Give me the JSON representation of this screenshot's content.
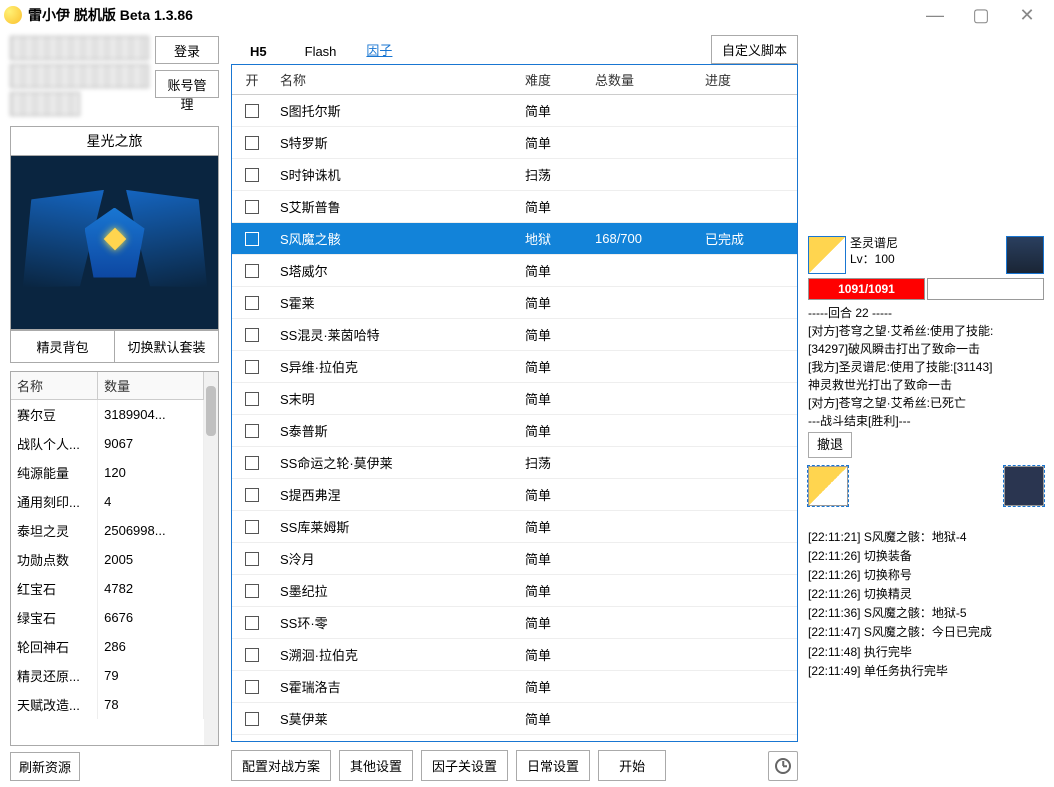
{
  "title": "雷小伊 脱机版 Beta 1.3.86",
  "login": {
    "login_btn": "登录",
    "account_mgmt": "账号管理"
  },
  "character": {
    "title": "星光之旅",
    "sprite_bag": "精灵背包",
    "switch_default": "切换默认套装"
  },
  "resources": {
    "col_name": "名称",
    "col_qty": "数量",
    "rows": [
      {
        "name": "赛尔豆",
        "qty": "3189904..."
      },
      {
        "name": "战队个人...",
        "qty": "9067"
      },
      {
        "name": "纯源能量",
        "qty": "120"
      },
      {
        "name": "通用刻印...",
        "qty": "4"
      },
      {
        "name": "泰坦之灵",
        "qty": "2506998..."
      },
      {
        "name": "功勋点数",
        "qty": "2005"
      },
      {
        "name": "红宝石",
        "qty": "4782"
      },
      {
        "name": "绿宝石",
        "qty": "6676"
      },
      {
        "name": "轮回神石",
        "qty": "286"
      },
      {
        "name": "精灵还原...",
        "qty": "79"
      },
      {
        "name": "天赋改造...",
        "qty": "78"
      }
    ],
    "refresh": "刷新资源"
  },
  "tabs": {
    "h5": "H5",
    "flash": "Flash",
    "factor": "因子",
    "custom": "自定义脚本"
  },
  "main": {
    "cols": {
      "open": "开",
      "name": "名称",
      "diff": "难度",
      "total": "总数量",
      "prog": "进度"
    },
    "rows": [
      {
        "name": "S图托尔斯",
        "diff": "简单",
        "total": "",
        "prog": ""
      },
      {
        "name": "S特罗斯",
        "diff": "简单",
        "total": "",
        "prog": ""
      },
      {
        "name": "S时钟诛机",
        "diff": "扫荡",
        "total": "",
        "prog": ""
      },
      {
        "name": "S艾斯普鲁",
        "diff": "简单",
        "total": "",
        "prog": ""
      },
      {
        "name": "S风魔之骸",
        "diff": "地狱",
        "total": "168/700",
        "prog": "已完成",
        "sel": true
      },
      {
        "name": "S塔威尔",
        "diff": "简单",
        "total": "",
        "prog": ""
      },
      {
        "name": "S霍莱",
        "diff": "简单",
        "total": "",
        "prog": ""
      },
      {
        "name": "SS混灵·莱茵哈特",
        "diff": "简单",
        "total": "",
        "prog": ""
      },
      {
        "name": "S异维·拉伯克",
        "diff": "简单",
        "total": "",
        "prog": ""
      },
      {
        "name": "S末明",
        "diff": "简单",
        "total": "",
        "prog": ""
      },
      {
        "name": "S泰普斯",
        "diff": "简单",
        "total": "",
        "prog": ""
      },
      {
        "name": "SS命运之轮·莫伊莱",
        "diff": "扫荡",
        "total": "",
        "prog": ""
      },
      {
        "name": "S提西弗涅",
        "diff": "简单",
        "total": "",
        "prog": ""
      },
      {
        "name": "SS库莱姆斯",
        "diff": "简单",
        "total": "",
        "prog": ""
      },
      {
        "name": "S泠月",
        "diff": "简单",
        "total": "",
        "prog": ""
      },
      {
        "name": "S墨纪拉",
        "diff": "简单",
        "total": "",
        "prog": ""
      },
      {
        "name": "SS环·零",
        "diff": "简单",
        "total": "",
        "prog": ""
      },
      {
        "name": "S溯洄·拉伯克",
        "diff": "简单",
        "total": "",
        "prog": ""
      },
      {
        "name": "S霍瑞洛吉",
        "diff": "简单",
        "total": "",
        "prog": ""
      },
      {
        "name": "S莫伊莱",
        "diff": "简单",
        "total": "",
        "prog": ""
      }
    ]
  },
  "bottom": {
    "battle_plan": "配置对战方案",
    "other": "其他设置",
    "factor_gate": "因子关设置",
    "daily": "日常设置",
    "start": "开始"
  },
  "battle": {
    "pet_name": "圣灵谱尼",
    "pet_level": "Lv：100",
    "hp": "1091/1091",
    "round": "-----回合 22 -----",
    "lines": [
      "[对方]苍穹之望·艾希丝:使用了技能:",
      "[34297]破风瞬击打出了致命一击",
      "[我方]圣灵谱尼:使用了技能:[31143]",
      "神灵救世光打出了致命一击",
      "[对方]苍穹之望·艾希丝:已死亡",
      "---战斗结束[胜利]---"
    ],
    "withdraw": "撤退"
  },
  "events": [
    "[22:11:21] S风魔之骸：地狱-4",
    "[22:11:26] 切换装备",
    "[22:11:26] 切换称号",
    "[22:11:26] 切换精灵",
    "[22:11:36] S风魔之骸：地狱-5",
    "[22:11:47] S风魔之骸：今日已完成",
    "[22:11:48] 执行完毕",
    "[22:11:49] 单任务执行完毕"
  ]
}
